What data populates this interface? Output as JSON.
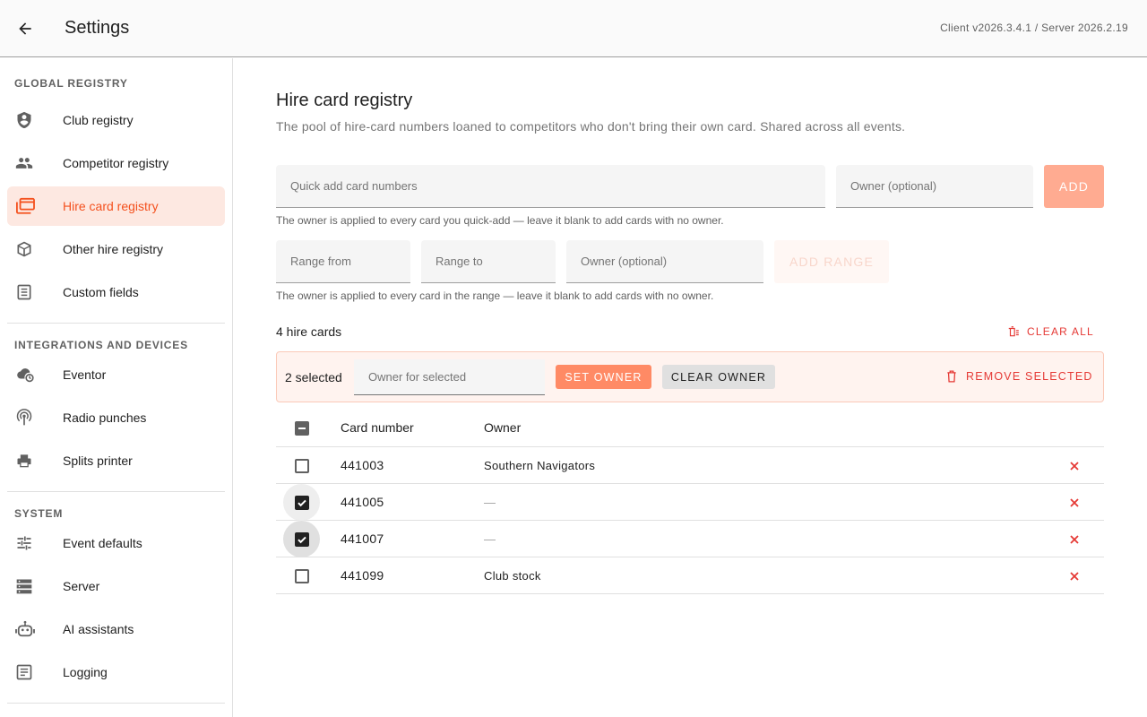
{
  "header": {
    "title": "Settings",
    "version": "Client v2026.3.4.1 / Server 2026.2.19"
  },
  "sidebar": {
    "sections": [
      {
        "title": "GLOBAL REGISTRY",
        "items": [
          {
            "label": "Club registry",
            "icon": "shield-person-icon"
          },
          {
            "label": "Competitor registry",
            "icon": "people-icon"
          },
          {
            "label": "Hire card registry",
            "icon": "cards-icon",
            "active": true
          },
          {
            "label": "Other hire registry",
            "icon": "box-icon"
          },
          {
            "label": "Custom fields",
            "icon": "form-icon"
          }
        ]
      },
      {
        "title": "INTEGRATIONS AND DEVICES",
        "items": [
          {
            "label": "Eventor",
            "icon": "cloud-sync-icon"
          },
          {
            "label": "Radio punches",
            "icon": "antenna-icon"
          },
          {
            "label": "Splits printer",
            "icon": "printer-icon"
          }
        ]
      },
      {
        "title": "SYSTEM",
        "items": [
          {
            "label": "Event defaults",
            "icon": "sliders-icon"
          },
          {
            "label": "Server",
            "icon": "server-icon"
          },
          {
            "label": "AI assistants",
            "icon": "robot-icon"
          },
          {
            "label": "Logging",
            "icon": "log-icon"
          }
        ]
      }
    ]
  },
  "main": {
    "title": "Hire card registry",
    "description": "The pool of hire-card numbers loaned to competitors who don't bring their own card. Shared across all events.",
    "quick_add": {
      "placeholder": "Quick add card numbers",
      "owner_placeholder": "Owner (optional)",
      "button": "ADD",
      "hint": "The owner is applied to every card you quick-add — leave it blank to add cards with no owner."
    },
    "range": {
      "from_placeholder": "Range from",
      "to_placeholder": "Range to",
      "owner_placeholder": "Owner (optional)",
      "button": "ADD RANGE",
      "hint": "The owner is applied to every card in the range — leave it blank to add cards with no owner."
    },
    "count_label": "4 hire cards",
    "clear_all": "CLEAR ALL",
    "selection": {
      "count": "2 selected",
      "owner_placeholder": "Owner for selected",
      "set_owner": "SET OWNER",
      "clear_owner": "CLEAR OWNER",
      "remove_selected": "REMOVE SELECTED"
    },
    "table": {
      "columns": [
        "Card number",
        "Owner"
      ],
      "rows": [
        {
          "card": "441003",
          "owner": "Southern Navigators",
          "checked": false
        },
        {
          "card": "441005",
          "owner": "—",
          "checked": true
        },
        {
          "card": "441007",
          "owner": "—",
          "checked": true
        },
        {
          "card": "441099",
          "owner": "Club stock",
          "checked": false
        }
      ]
    }
  },
  "colors": {
    "accent": "#f4511e",
    "accent_light": "#ffab91",
    "danger": "#e53935"
  }
}
